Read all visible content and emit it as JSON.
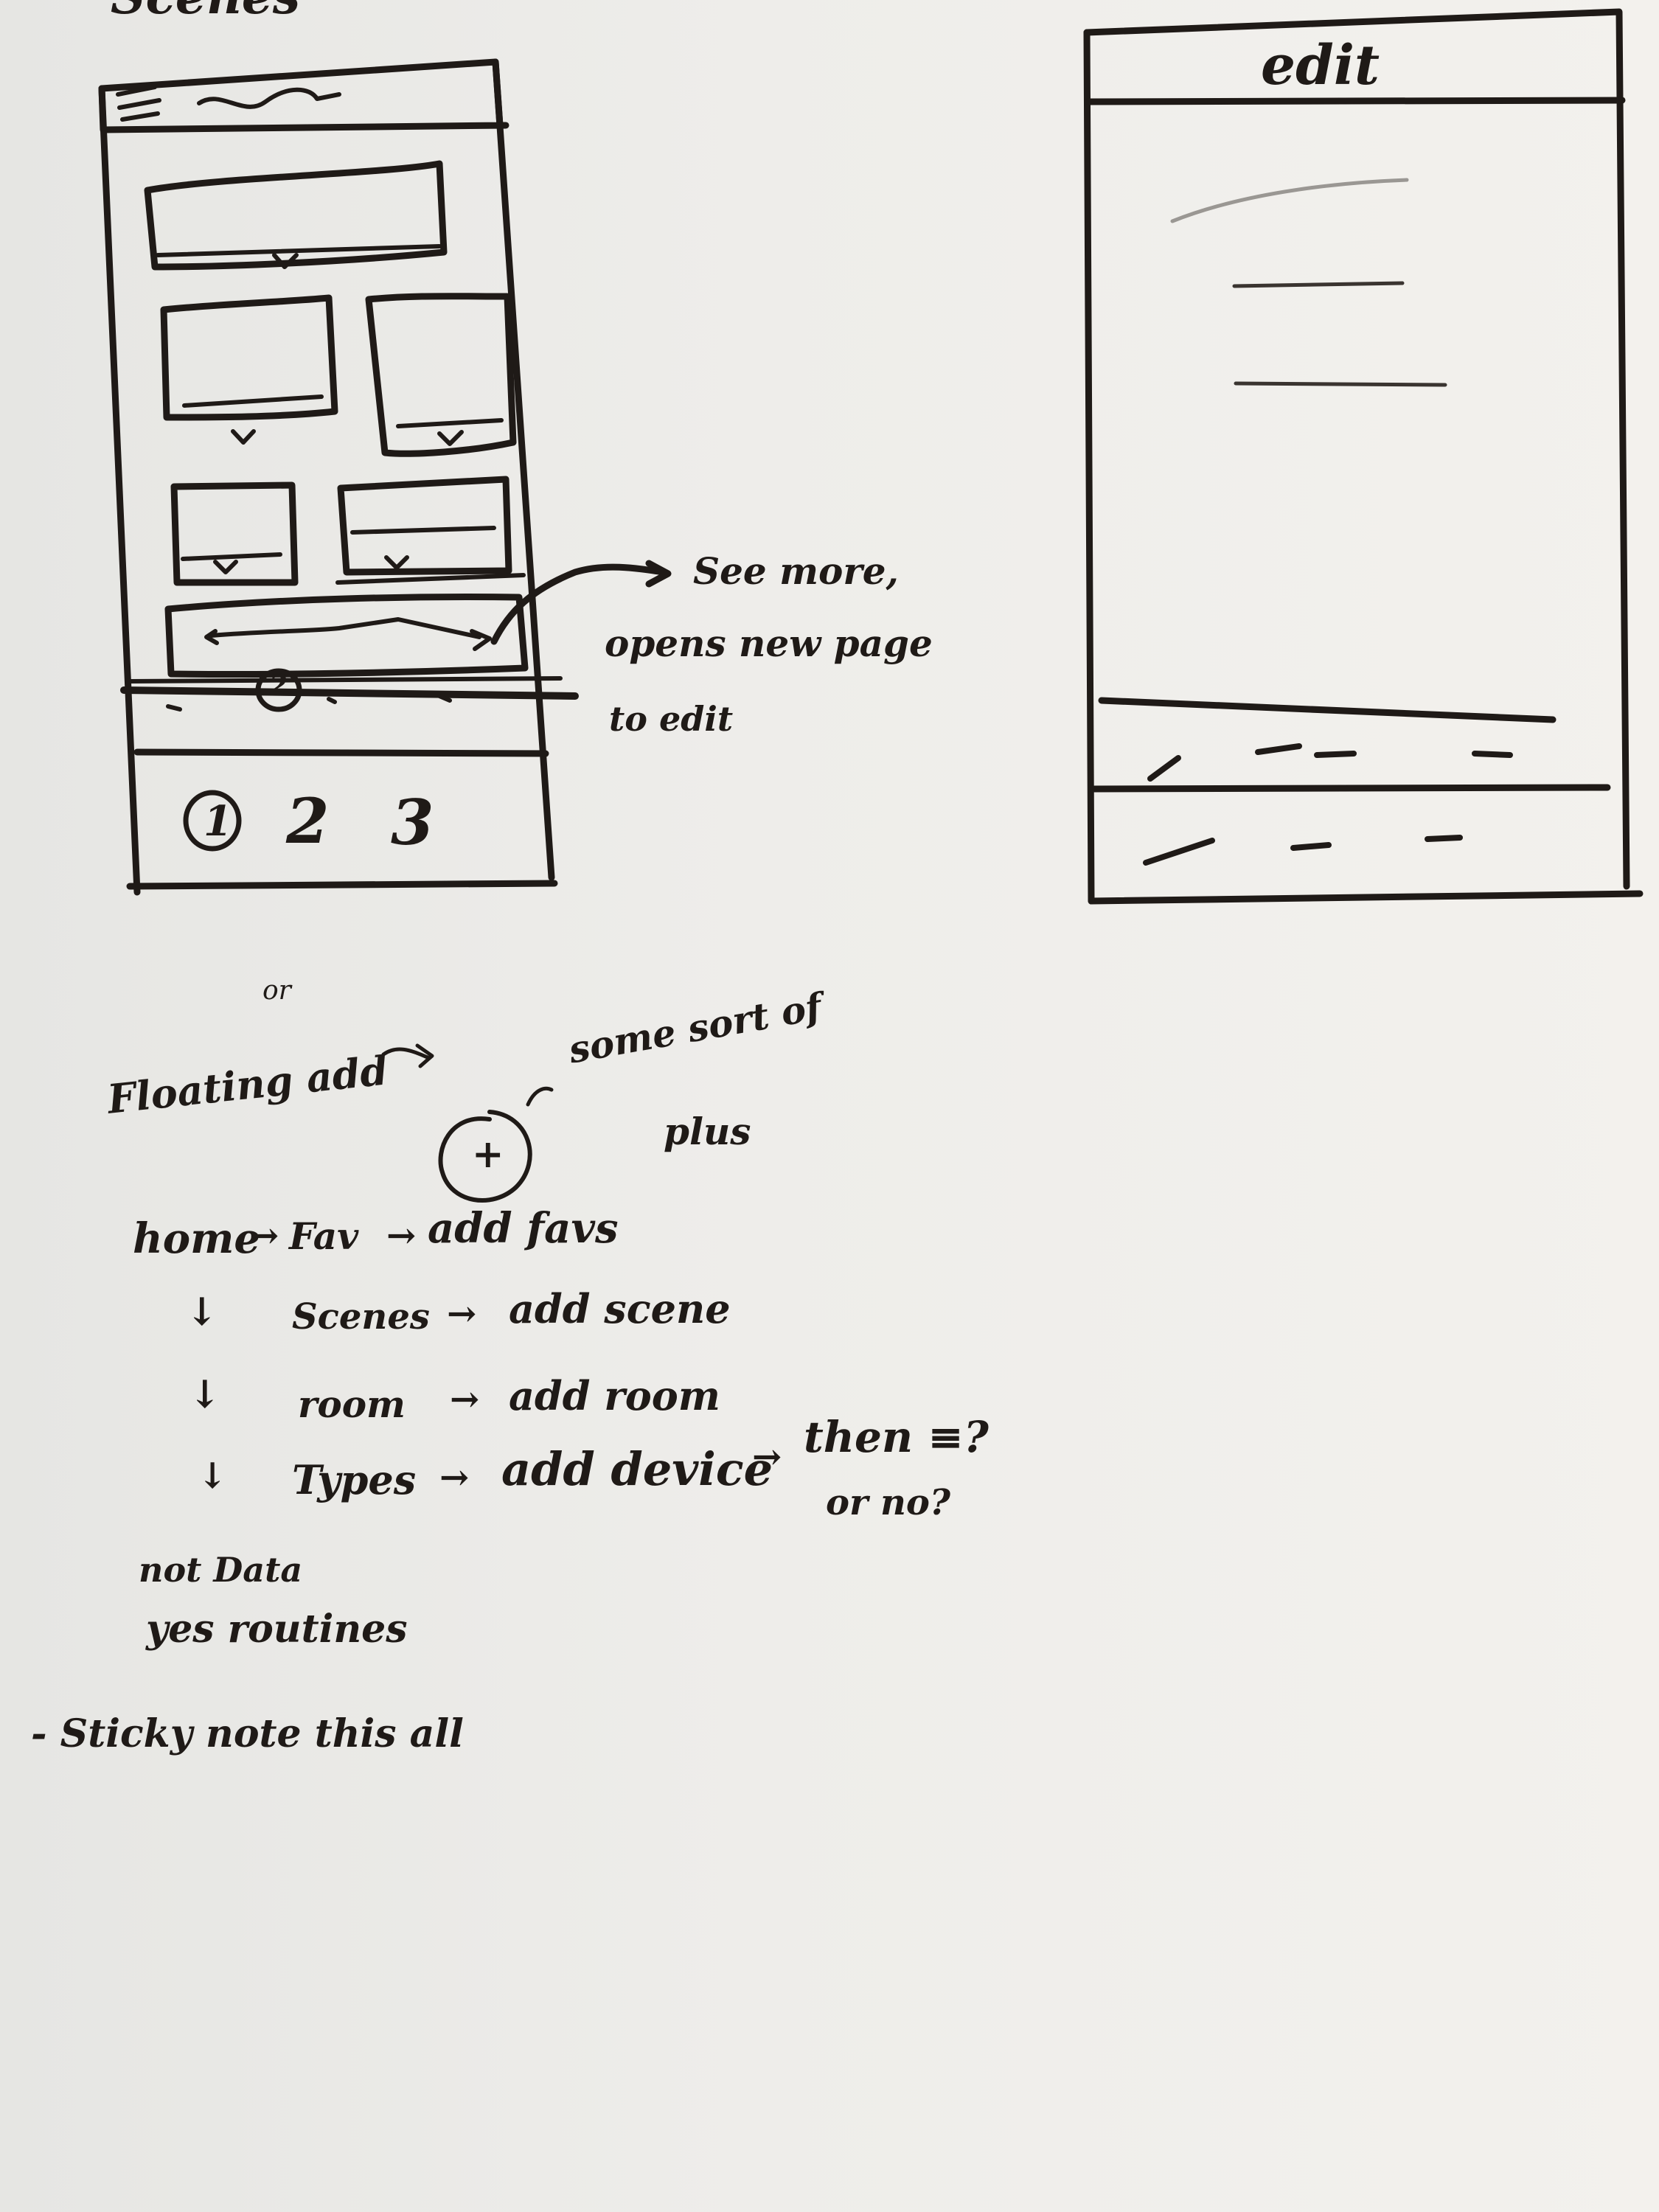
{
  "left_sketch": {
    "header_title": "Scenes",
    "pagination": {
      "current": "1",
      "pages": [
        "2",
        "3"
      ]
    },
    "carousel_marker": "2",
    "annotation": [
      "See more,",
      "opens new page",
      "to edit"
    ]
  },
  "right_sketch": {
    "header_title": "edit"
  },
  "notes": {
    "or": "or",
    "floating_add": "Floating add",
    "plus_symbol": "+",
    "plus_note": [
      "some sort of",
      "plus"
    ],
    "flow": {
      "home": "home",
      "fav": "Fav",
      "add_favs": "add favs",
      "scenes": "Scenes",
      "add_scene": "add scene",
      "room": "room",
      "add_room": "add room",
      "types": "Types",
      "add_device": "add device",
      "then": "then ≡?",
      "or_no": "or no?"
    },
    "not_data": "not Data",
    "yes_routines": "yes routines",
    "sticky": "- Sticky note this all"
  },
  "colors": {
    "ink": "#1f1a17",
    "paper": "#eeedea"
  }
}
